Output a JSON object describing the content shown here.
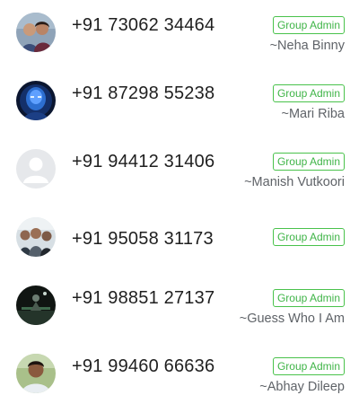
{
  "participants": [
    {
      "phone": "+91 73062 34464",
      "badge": "Group Admin",
      "nickname": "~Neha Binny",
      "avatar_icon": "couple-photo-avatar"
    },
    {
      "phone": "+91 87298 55238",
      "badge": "Group Admin",
      "nickname": "~Mari Riba",
      "avatar_icon": "blue-character-avatar"
    },
    {
      "phone": "+91 94412 31406",
      "badge": "Group Admin",
      "nickname": "~Manish Vutkoori",
      "avatar_icon": "default-person-avatar"
    },
    {
      "phone": "+91 95058 31173",
      "badge": "Group Admin",
      "nickname": "",
      "avatar_icon": "group-selfie-avatar"
    },
    {
      "phone": "+91 98851 27137",
      "badge": "Group Admin",
      "nickname": "~Guess Who I Am",
      "avatar_icon": "dark-stage-avatar"
    },
    {
      "phone": "+91 99460 66636",
      "badge": "Group Admin",
      "nickname": "~Abhay Dileep",
      "avatar_icon": "man-portrait-avatar"
    }
  ],
  "colors": {
    "badge_green": "#3fb447",
    "phone_text": "#1f1f1f",
    "nickname_text": "#5f6368"
  }
}
